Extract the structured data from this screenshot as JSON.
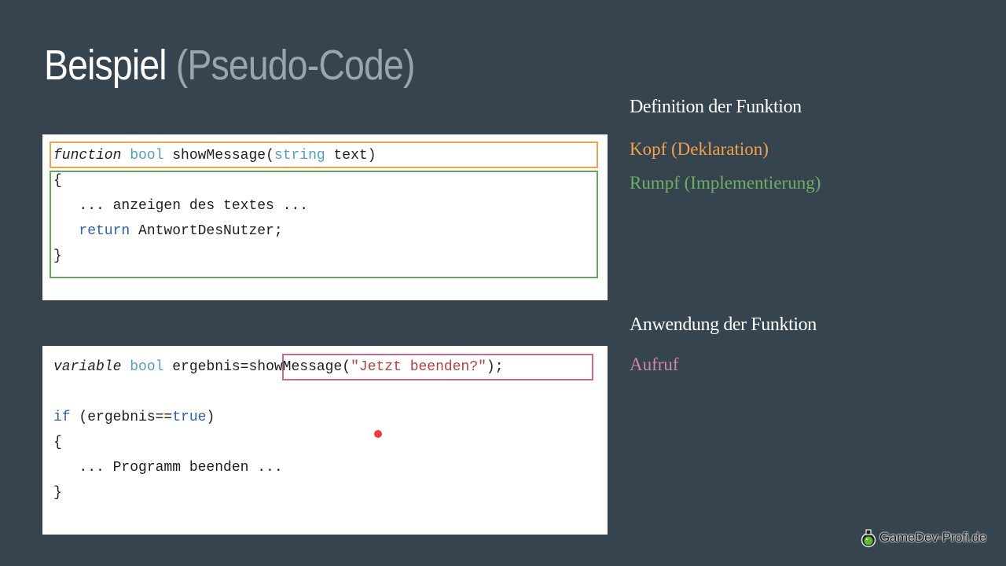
{
  "slide": {
    "title_main": "Beispiel",
    "title_sub": "(Pseudo-Code)"
  },
  "code_definition": {
    "line1": {
      "t1": "function",
      "t2": " ",
      "t3": "bool",
      "t4": " showMessage(",
      "t5": "string",
      "t6": " text)"
    },
    "line2": "{",
    "line3": "   ... anzeigen des textes ...",
    "line4": {
      "indent": "   ",
      "kw": "return",
      "rest": " AntwortDesNutzer;"
    },
    "line5": "}"
  },
  "code_usage": {
    "line1": {
      "t1": "variable",
      "t2": " ",
      "t3": "bool",
      "t4": " ergebnis=showMessage(",
      "t5": "\"Jetzt beenden?\"",
      "t6": ");"
    },
    "line2": {
      "kw": "if",
      "mid": " (ergebnis==",
      "kw2": "true",
      "end": ")"
    },
    "line3": "{",
    "line4": "   ... Programm beenden ...",
    "line5": "}"
  },
  "sidebar": {
    "definition_heading": "Definition der Funktion",
    "head_label": "Kopf (Deklaration)",
    "body_label": "Rumpf (Implementierung)",
    "usage_heading": "Anwendung der Funktion",
    "call_label": "Aufruf"
  },
  "logo": {
    "text": "GameDev-Profi.de",
    "icon": "potion-flask-icon"
  },
  "colors": {
    "background": "#35444f",
    "head_highlight": "#f2a24a",
    "body_highlight": "#66a75d",
    "call_highlight": "#c66a92",
    "pointer": "#ee3b3b"
  }
}
